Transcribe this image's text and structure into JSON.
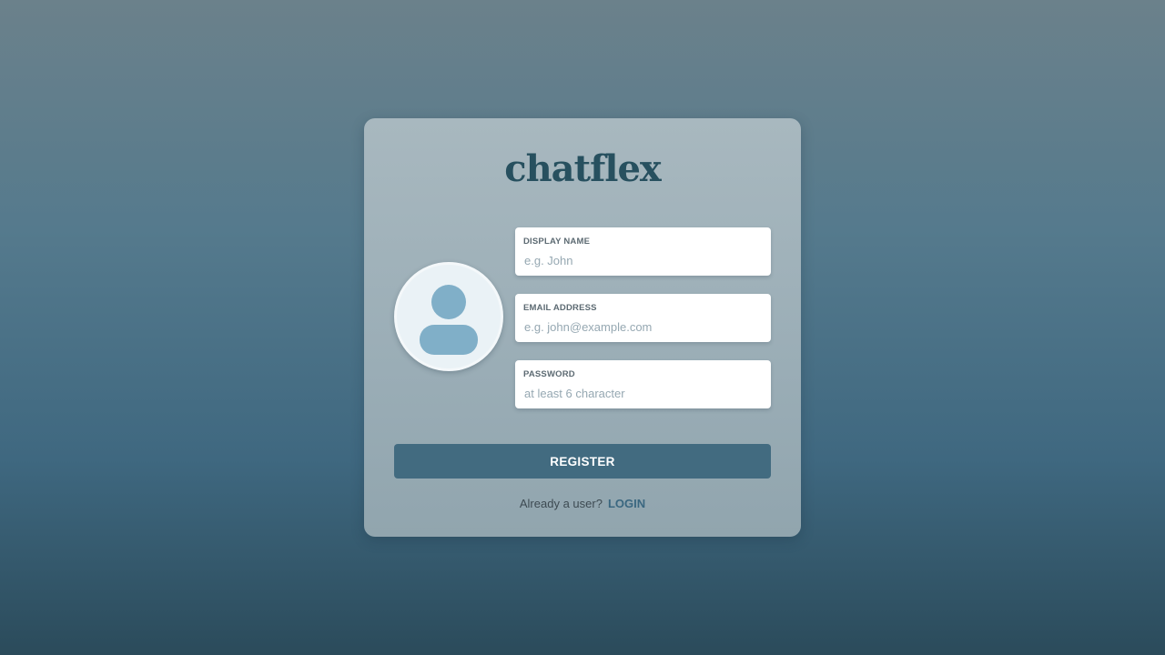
{
  "app": {
    "logo_text": "chatflex"
  },
  "avatar": {
    "icon": "user-placeholder-icon",
    "bg_color": "#eaf2f6",
    "figure_color": "#80afc8"
  },
  "form": {
    "display_name": {
      "label": "DISPLAY NAME",
      "placeholder": "e.g. John",
      "value": ""
    },
    "email": {
      "label": "EMAIL ADDRESS",
      "placeholder": "e.g. john@example.com",
      "value": ""
    },
    "password": {
      "label": "PASSWORD",
      "placeholder": "at least 6 character",
      "value": ""
    },
    "register_label": "REGISTER"
  },
  "footer": {
    "prompt": "Already a user?",
    "login_label": "LOGIN"
  },
  "colors": {
    "brand": "#27505f",
    "button": "#426b80",
    "link": "#3a6780"
  }
}
